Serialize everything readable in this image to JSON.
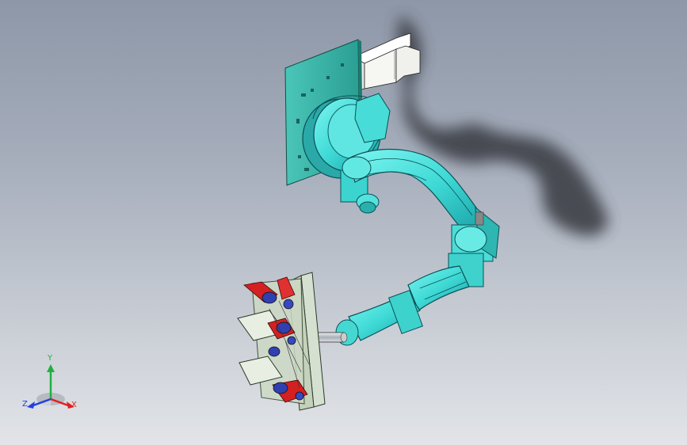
{
  "viewport": {
    "background_top": "#8e97a8",
    "background_bottom": "#e2e4e8",
    "model_colors": {
      "robot_body": "#3fe0dc",
      "robot_dark": "#0f6f78",
      "base_plate": "#36b0a4",
      "bracket": "#f2f2ee",
      "gripper_frame": "#c8d5c0",
      "gripper_red": "#d42020",
      "gripper_blue": "#3040b0",
      "shadow": "#3c4046"
    }
  },
  "triad": {
    "y_label": "Y",
    "x_label": "X",
    "z_label": "Z",
    "y_color": "#20b040",
    "x_color": "#e02020",
    "z_color": "#2040e0"
  }
}
